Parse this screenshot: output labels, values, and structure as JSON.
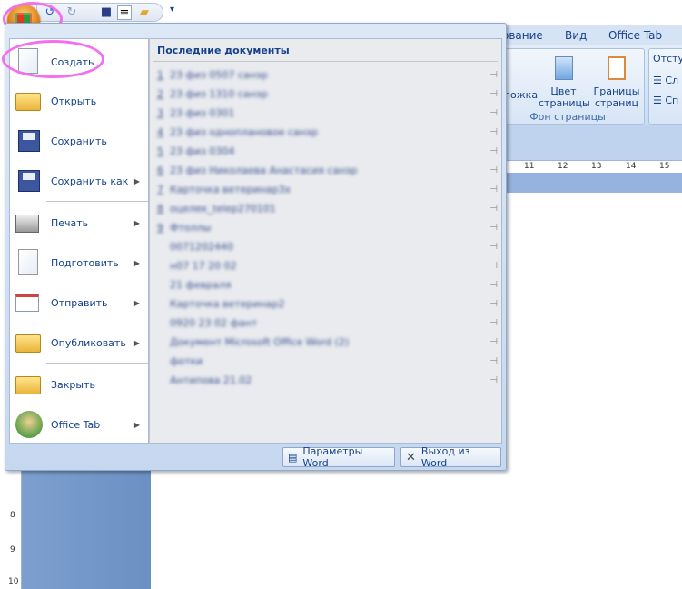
{
  "quick_access": {
    "icons": [
      "undo-icon",
      "redo-icon",
      "save-icon",
      "align-icon",
      "open-folder-icon"
    ],
    "customize": "▾"
  },
  "ribbon": {
    "tabs": [
      "ование",
      "Вид",
      "Office Tab"
    ],
    "group1": {
      "label": "Фон страницы",
      "buttons": [
        "ложка",
        "Цвет страницы",
        "Границы страниц"
      ]
    },
    "group2": {
      "label": "Отсту",
      "items": [
        "Сл",
        "Сп"
      ]
    }
  },
  "ruler": {
    "ticks": [
      "11",
      "12",
      "13",
      "14",
      "15"
    ],
    "vticks": [
      "8",
      "9",
      "10"
    ]
  },
  "menu": {
    "items": [
      {
        "label": "Создать",
        "icon": "new-document-icon",
        "arrow": false
      },
      {
        "label": "Открыть",
        "icon": "open-folder-icon",
        "arrow": false
      },
      {
        "label": "Сохранить",
        "icon": "save-icon",
        "arrow": false
      },
      {
        "label": "Сохранить как",
        "icon": "save-as-icon",
        "arrow": true
      },
      {
        "label": "Печать",
        "icon": "printer-icon",
        "arrow": true
      },
      {
        "label": "Подготовить",
        "icon": "prepare-icon",
        "arrow": true
      },
      {
        "label": "Отправить",
        "icon": "send-icon",
        "arrow": true
      },
      {
        "label": "Опубликовать",
        "icon": "publish-icon",
        "arrow": true
      },
      {
        "label": "Закрыть",
        "icon": "close-folder-icon",
        "arrow": false
      },
      {
        "label": "Office Tab",
        "icon": "office-tab-icon",
        "arrow": true
      }
    ],
    "recent_title": "Последние документы",
    "recent": [
      {
        "num": "1",
        "name": "23 физ 0507 санэр"
      },
      {
        "num": "2",
        "name": "23 физ 1310 санэр"
      },
      {
        "num": "3",
        "name": "23 физ 0301"
      },
      {
        "num": "4",
        "name": "23 физ одноплановое санэр"
      },
      {
        "num": "5",
        "name": "23 физ 0304"
      },
      {
        "num": "6",
        "name": "23 физ Николаева Анастасия санэр"
      },
      {
        "num": "7",
        "name": "Карточка ветеринар3х"
      },
      {
        "num": "8",
        "name": "оцелек_telep270101"
      },
      {
        "num": "9",
        "name": "Фтоллы"
      },
      {
        "num": "",
        "name": "0071202440"
      },
      {
        "num": "",
        "name": "н07 17 20 02"
      },
      {
        "num": "",
        "name": "21 февраля"
      },
      {
        "num": "",
        "name": "Карточка ветеринар2"
      },
      {
        "num": "",
        "name": "0920 23 02 фант"
      },
      {
        "num": "",
        "name": "Документ Microsoft Office Word (2)"
      },
      {
        "num": "",
        "name": "фотки"
      },
      {
        "num": "",
        "name": "Антипова 21.02"
      }
    ],
    "options_button": "Параметры Word",
    "exit_button": "Выход из Word"
  },
  "colors": {
    "annotation": "#f36ef0",
    "menu_text": "#15428b"
  }
}
